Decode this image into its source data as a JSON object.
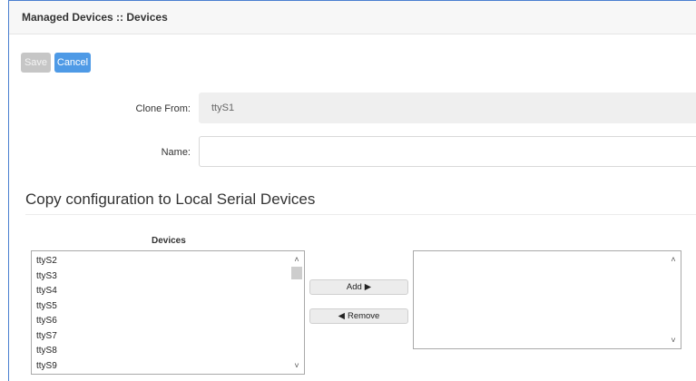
{
  "header": {
    "title": "Managed Devices :: Devices"
  },
  "toolbar": {
    "save_label": "Save",
    "cancel_label": "Cancel"
  },
  "form": {
    "clone_from_label": "Clone From:",
    "clone_from_value": "ttyS1",
    "name_label": "Name:",
    "name_value": ""
  },
  "section": {
    "title": "Copy configuration to Local Serial Devices"
  },
  "devices": {
    "label": "Devices",
    "available": [
      "ttyS2",
      "ttyS3",
      "ttyS4",
      "ttyS5",
      "ttyS6",
      "ttyS7",
      "ttyS8",
      "ttyS9"
    ],
    "selected": []
  },
  "transfer": {
    "add_label": "Add",
    "add_icon": "right-triangle-icon",
    "remove_label": "Remove",
    "remove_icon": "left-triangle-icon"
  }
}
